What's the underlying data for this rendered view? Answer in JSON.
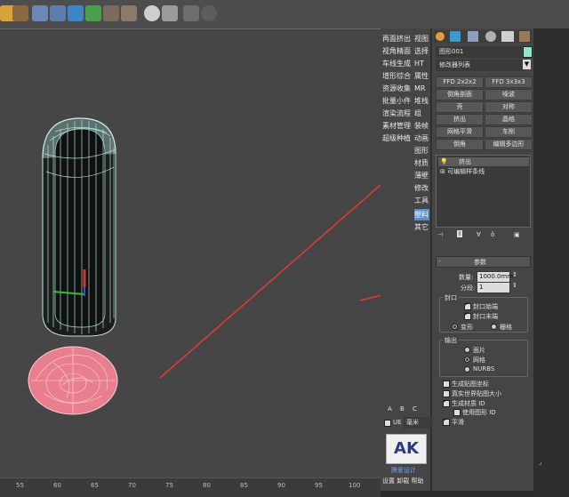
{
  "left_menu": {
    "items": [
      "再面挤出",
      "视角精面",
      "车线生成",
      "增形综合",
      "资源收集",
      "批量小件",
      "渲染流程",
      "素材管理",
      "超级种植"
    ],
    "items_col2": [
      "视图",
      "选择",
      "HT",
      "属性",
      "MR",
      "堆栈",
      "组",
      "装帧",
      "动画",
      "图形",
      "材质",
      "薄壁",
      "修改",
      "工具",
      "塑料",
      "其它"
    ],
    "selected_index": 14
  },
  "command_panel": {
    "object_name": "图形001",
    "modifier_list": "修改器列表",
    "buttons": [
      "FFD 2x2x2",
      "FFD 3x3x3",
      "倒角剖面",
      "噪波",
      "壳",
      "对称",
      "挤出",
      "晶格",
      "网格平滑",
      "车削",
      "倒角",
      "编辑多边形"
    ],
    "stack": [
      "挤出",
      "可编辑样条线"
    ],
    "params_title": "参数",
    "amount_label": "数量:",
    "amount_value": "1000.0mm",
    "segments_label": "分段:",
    "segments_value": "1",
    "capping_title": "封口",
    "cap_start": "封口始端",
    "cap_end": "封口末端",
    "morph": "变形",
    "grid": "栅格",
    "output_title": "输出",
    "patch": "面片",
    "mesh": "网格",
    "nurbs": "NURBS",
    "gen_map": "生成贴图坐标",
    "real_world": "真实世界贴图大小",
    "gen_mat": "生成材质 ID",
    "use_shape": "使用图形 ID",
    "smooth": "平滑"
  },
  "side_tabs": {
    "a": "A",
    "b": "B",
    "c": "C",
    "units": "毫米",
    "ue": "UE",
    "logo": "AK",
    "logo_caption": "腾爱设计",
    "bottom_menu": "设置 卸载 帮助"
  },
  "timeline": {
    "ticks": [
      "55",
      "60",
      "65",
      "70",
      "75",
      "80",
      "85",
      "90",
      "95",
      "100"
    ]
  }
}
